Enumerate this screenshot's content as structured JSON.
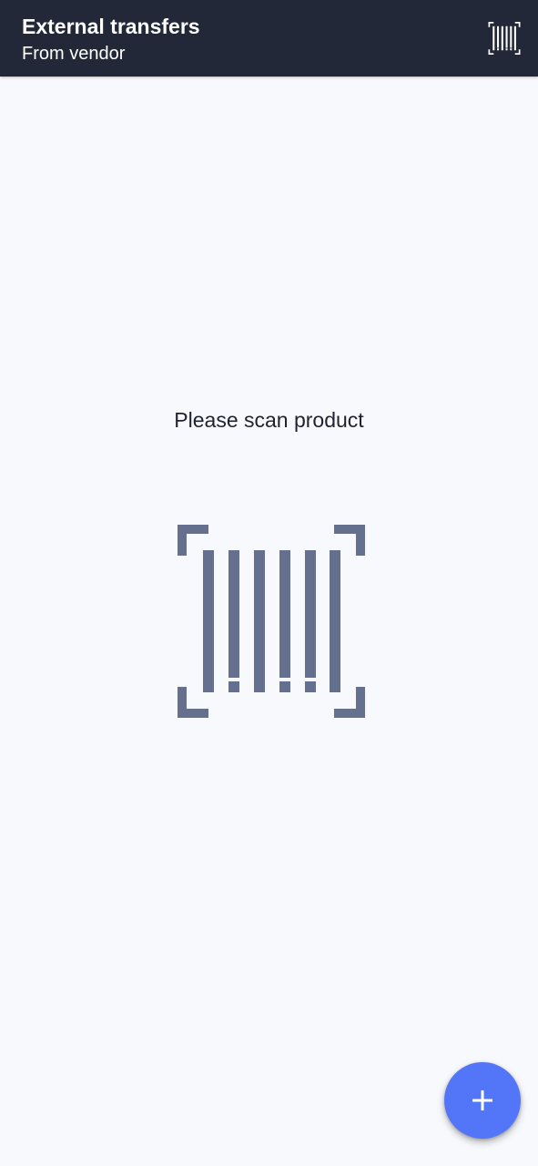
{
  "header": {
    "title": "External transfers",
    "subtitle": "From vendor",
    "action_icon": "barcode-scan-icon",
    "background_color": "#232838"
  },
  "main": {
    "prompt": "Please scan product",
    "illustration_icon": "barcode-scan-icon",
    "illustration_color": "#65708f",
    "background_color": "#f8f9fc"
  },
  "fab": {
    "icon": "plus-icon",
    "color": "#5276f7"
  }
}
